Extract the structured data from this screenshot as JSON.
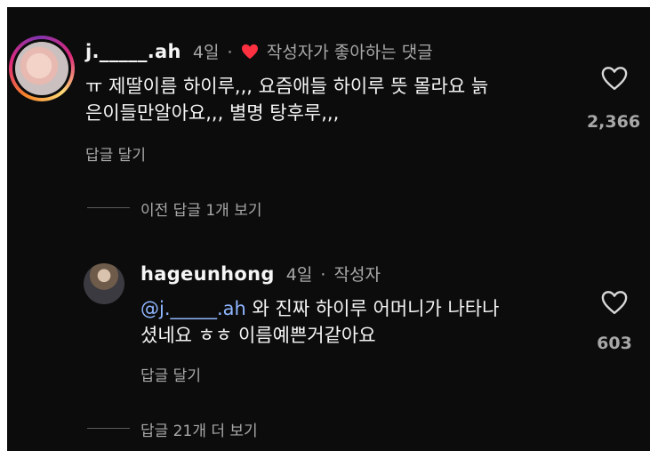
{
  "comment": {
    "username": "j._____.ah",
    "time": "4일",
    "separator": "·",
    "author_liked_label": "작성자가 좋아하는 댓글",
    "text_line1": "ㅠ 제딸이름 하이루,,, 요즘애들 하이루 뜻 몰라요 늙",
    "text_line2": "은이들만알아요,,, 별명 탕후루,,,",
    "reply_label": "답글 달기",
    "like_count": "2,366",
    "heart_icon": "heart-outline-icon",
    "author_heart_icon": "heart-filled-icon",
    "author_heart_color": "#ff3040"
  },
  "prev_replies_label": "이전 답글 1개 보기",
  "reply": {
    "username": "hageunhong",
    "time": "4일",
    "separator": "·",
    "author_badge": "작성자",
    "mention": "@j._____.ah",
    "text_line1": " 와 진짜 하이루 어머니가 나타나",
    "text_line2": "셨네요 ㅎㅎ 이름예쁜거같아요",
    "reply_label": "답글 달기",
    "like_count": "603",
    "heart_icon": "heart-outline-icon"
  },
  "more_replies_label": "답글 21개 더 보기",
  "colors": {
    "background": "#0c0c0c",
    "text": "#f5f5f5",
    "muted": "#a8a8a8",
    "mention": "#8fb6ff"
  }
}
